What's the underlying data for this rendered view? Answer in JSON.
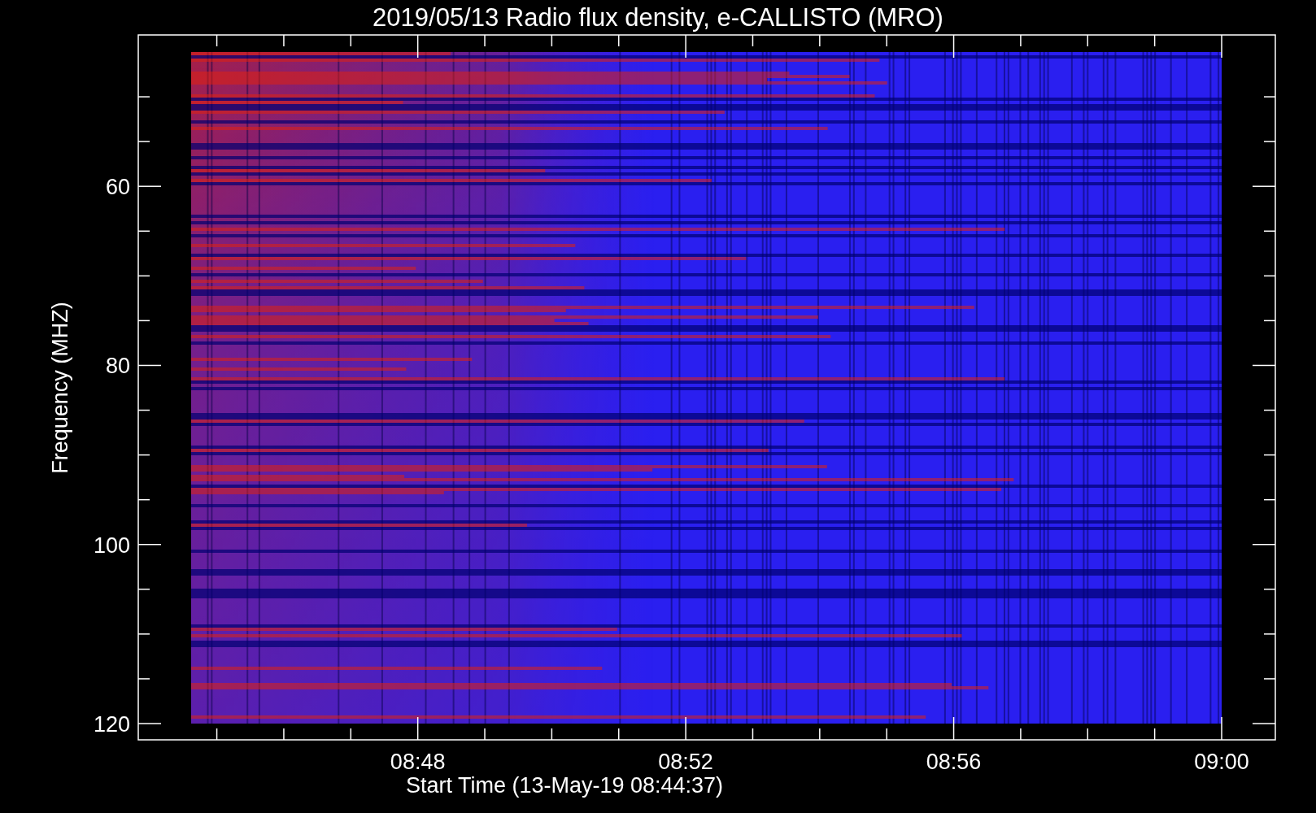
{
  "title": "2019/05/13  Radio flux density, e-CALLISTO (MRO)",
  "plot": {
    "ylabel": "Frequency (MHZ)",
    "xlabel": "Start Time (13-May-19 08:44:37)",
    "yticks": [
      "60",
      "80",
      "100",
      "120"
    ],
    "xticks": [
      "08:48",
      "08:52",
      "08:56",
      "09:00"
    ]
  }
}
